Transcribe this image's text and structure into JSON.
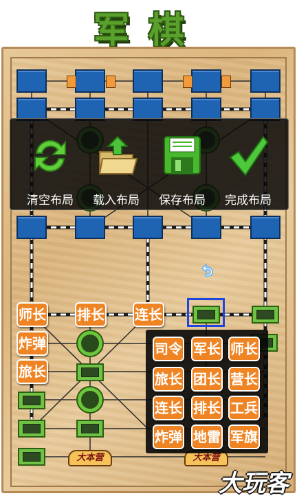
{
  "title": "军棋",
  "toolbar": {
    "clear_label": "清空布局",
    "load_label": "载入布局",
    "save_label": "保存布局",
    "done_label": "完成布局"
  },
  "board_pieces": [
    "师长",
    "排长",
    "连长",
    "炸弹",
    "旅长"
  ],
  "palette": [
    [
      "司令",
      "军长",
      "师长"
    ],
    [
      "旅长",
      "团长",
      "营长"
    ],
    [
      "连长",
      "排长",
      "工兵"
    ],
    [
      "炸弹",
      "地雷",
      "军旗"
    ]
  ],
  "headquarters_label": "大本营",
  "watermark": "大玩客",
  "colors": {
    "piece_orange": "#ef8424",
    "enemy_blue": "#1f63b3",
    "post_green": "#6fc243",
    "select_blue": "#1f45e0"
  },
  "icons": [
    "refresh-icon",
    "folder-open-icon",
    "floppy-disk-icon",
    "checkmark-icon",
    "undo-arrow-icon"
  ]
}
